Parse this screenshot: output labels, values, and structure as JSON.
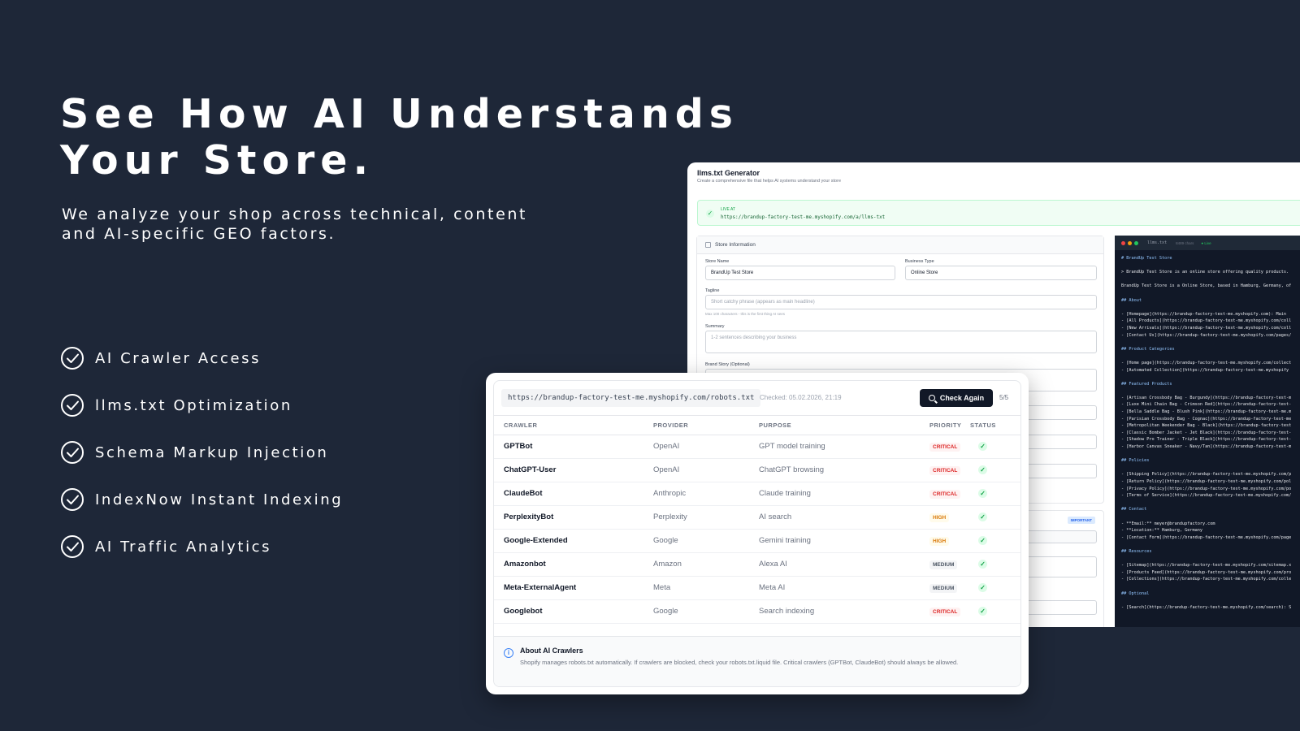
{
  "headline": {
    "line1": "See How AI Understands",
    "line2": "Your Store."
  },
  "subheadline": {
    "line1": "We analyze your shop across technical, content",
    "line2": "and AI-specific GEO factors."
  },
  "features": [
    {
      "label": "AI Crawler Access",
      "icon": "check-circle-icon"
    },
    {
      "label": "llms.txt Optimization",
      "icon": "check-circle-icon"
    },
    {
      "label": "Schema Markup Injection",
      "icon": "check-circle-icon"
    },
    {
      "label": "IndexNow Instant Indexing",
      "icon": "check-circle-icon"
    },
    {
      "label": "AI Traffic Analytics",
      "icon": "check-circle-icon"
    }
  ],
  "generator": {
    "title": "llms.txt Generator",
    "subtitle": "Create a comprehensive file that helps AI systems understand your store",
    "live_label": "LIVE AT",
    "live_url": "https://brandup-factory-test-me.myshopify.com/a/llms-txt",
    "store_info_title": "Store Information",
    "store_name_label": "Store Name",
    "store_name_value": "BrandUp Test Store",
    "business_type_label": "Business Type",
    "business_type_value": "Online Store",
    "tagline_label": "Tagline",
    "tagline_placeholder": "Short catchy phrase (appears as main headline)",
    "tagline_hint": "Max 100 characters - this is the first thing AI sees",
    "summary_label": "Summary",
    "summary_placeholder": "1-2 sentences describing your business",
    "brand_story_label": "Brand Story (Optional)",
    "important_badge": "IMPORTANT",
    "code_filename": "llms.txt",
    "code_chars": "8489 chars",
    "code_live": "● Live",
    "code_lines": [
      "# BrandUp Test Store",
      "",
      "> BrandUp Test Store is an online store offering quality products.",
      "",
      "BrandUp Test Store is a Online Store, based in Hamburg, Germany, of",
      "",
      "## About",
      "",
      "- [Homepage](https://brandup-factory-test-me.myshopify.com): Main",
      "- [All Products](https://brandup-factory-test-me.myshopify.com/coll",
      "- [New Arrivals](https://brandup-factory-test-me.myshopify.com/coll",
      "- [Contact Us](https://brandup-factory-test-me.myshopify.com/pages/",
      "",
      "## Product Categories",
      "",
      "- [Home page](https://brandup-factory-test-me.myshopify.com/collect",
      "- [Automated Collection](https://brandup-factory-test-me.myshopify",
      "",
      "## Featured Products",
      "",
      "- [Artisan Crossbody Bag - Burgundy](https://brandup-factory-test-m",
      "- [Luxe Mini Chain Bag - Crimson Red](https://brandup-factory-test-",
      "- [Bella Saddle Bag - Blush Pink](https://brandup-factory-test-me.m",
      "- [Parisian Crossbody Bag - Cognac](https://brandup-factory-test-me",
      "- [Metropolitan Weekender Bag - Black](https://brandup-factory-test",
      "- [Classic Bomber Jacket - Jet Black](https://brandup-factory-test-",
      "- [Shadow Pro Trainer - Triple Black](https://brandup-factory-test-",
      "- [Harbor Canvas Sneaker - Navy/Tan](https://brandup-factory-test-m",
      "",
      "## Policies",
      "",
      "- [Shipping Policy](https://brandup-factory-test-me.myshopify.com/p",
      "- [Return Policy](https://brandup-factory-test-me.myshopify.com/pol",
      "- [Privacy Policy](https://brandup-factory-test-me.myshopify.com/po",
      "- [Terms of Service](https://brandup-factory-test-me.myshopify.com/",
      "",
      "## Contact",
      "",
      "- **Email:** meyer@brandupfactory.com",
      "- **Location:** Hamburg, Germany",
      "- [Contact Form](https://brandup-factory-test-me.myshopify.com/page",
      "",
      "## Resources",
      "",
      "- [Sitemap](https://brandup-factory-test-me.myshopify.com/sitemap.x",
      "- [Products Feed](https://brandup-factory-test-me.myshopify.com/pro",
      "- [Collections](https://brandup-factory-test-me.myshopify.com/colle",
      "",
      "## Optional",
      "",
      "- [Search](https://brandup-factory-test-me.myshopify.com/search): S"
    ]
  },
  "crawlers": {
    "url": "https://brandup-factory-test-me.myshopify.com/robots.txt",
    "checked": "Checked: 05.02.2026, 21:19",
    "check_again_label": "Check Again",
    "count": "5/5",
    "headers": {
      "crawler": "CRAWLER",
      "provider": "PROVIDER",
      "purpose": "PURPOSE",
      "priority": "PRIORITY",
      "status": "STATUS"
    },
    "rows": [
      {
        "crawler": "GPTBot",
        "provider": "OpenAI",
        "purpose": "GPT model training",
        "priority": "CRITICAL",
        "level": "critical",
        "status": "✓"
      },
      {
        "crawler": "ChatGPT-User",
        "provider": "OpenAI",
        "purpose": "ChatGPT browsing",
        "priority": "CRITICAL",
        "level": "critical",
        "status": "✓"
      },
      {
        "crawler": "ClaudeBot",
        "provider": "Anthropic",
        "purpose": "Claude training",
        "priority": "CRITICAL",
        "level": "critical",
        "status": "✓"
      },
      {
        "crawler": "PerplexityBot",
        "provider": "Perplexity",
        "purpose": "AI search",
        "priority": "HIGH",
        "level": "high",
        "status": "✓"
      },
      {
        "crawler": "Google-Extended",
        "provider": "Google",
        "purpose": "Gemini training",
        "priority": "HIGH",
        "level": "high",
        "status": "✓"
      },
      {
        "crawler": "Amazonbot",
        "provider": "Amazon",
        "purpose": "Alexa AI",
        "priority": "MEDIUM",
        "level": "medium",
        "status": "✓"
      },
      {
        "crawler": "Meta-ExternalAgent",
        "provider": "Meta",
        "purpose": "Meta AI",
        "priority": "MEDIUM",
        "level": "medium",
        "status": "✓"
      },
      {
        "crawler": "Googlebot",
        "provider": "Google",
        "purpose": "Search indexing",
        "priority": "CRITICAL",
        "level": "critical",
        "status": "✓"
      }
    ],
    "about_title": "About AI Crawlers",
    "about_text": "Shopify manages robots.txt automatically. If crawlers are blocked, check your robots.txt.liquid file. Critical crawlers (GPTBot, ClaudeBot) should always be allowed."
  },
  "colors": {
    "background": "#1e2738",
    "critical": "#dc2626",
    "high": "#d97706",
    "medium": "#4b5563",
    "success": "#16a34a",
    "button": "#111827"
  }
}
